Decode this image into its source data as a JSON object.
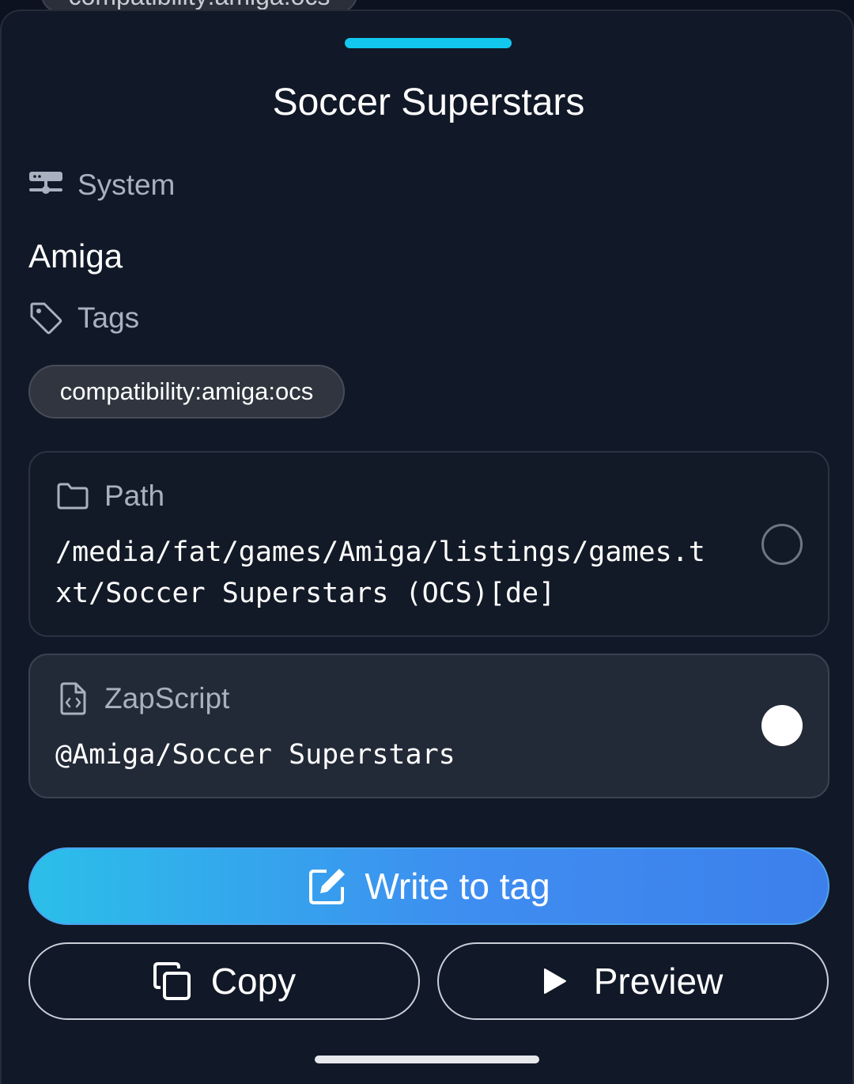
{
  "backdrop": {
    "tag_chip_label": "compatibility:amiga:ocs"
  },
  "sheet": {
    "title": "Soccer Superstars",
    "system": {
      "label": "System",
      "icon": "server-icon",
      "value": "Amiga"
    },
    "tags": {
      "label": "Tags",
      "icon": "tag-icon",
      "items": [
        "compatibility:amiga:ocs"
      ]
    },
    "path_option": {
      "label": "Path",
      "icon": "folder-icon",
      "value_line1": "/media/fat/games/Amiga/listings/games.t",
      "value_line2": "xt/Soccer Superstars (OCS)[de]",
      "selected": false
    },
    "zapscript_option": {
      "label": "ZapScript",
      "icon": "code-file-icon",
      "value": "@Amiga/Soccer Superstars",
      "selected": true
    },
    "actions": {
      "write_label": "Write to tag",
      "copy_label": "Copy",
      "preview_label": "Preview"
    }
  },
  "colors": {
    "background": "#111827",
    "accent": "#12c8ee",
    "primary_gradient_start": "#2bbfe9",
    "primary_gradient_end": "#3d80ec"
  }
}
